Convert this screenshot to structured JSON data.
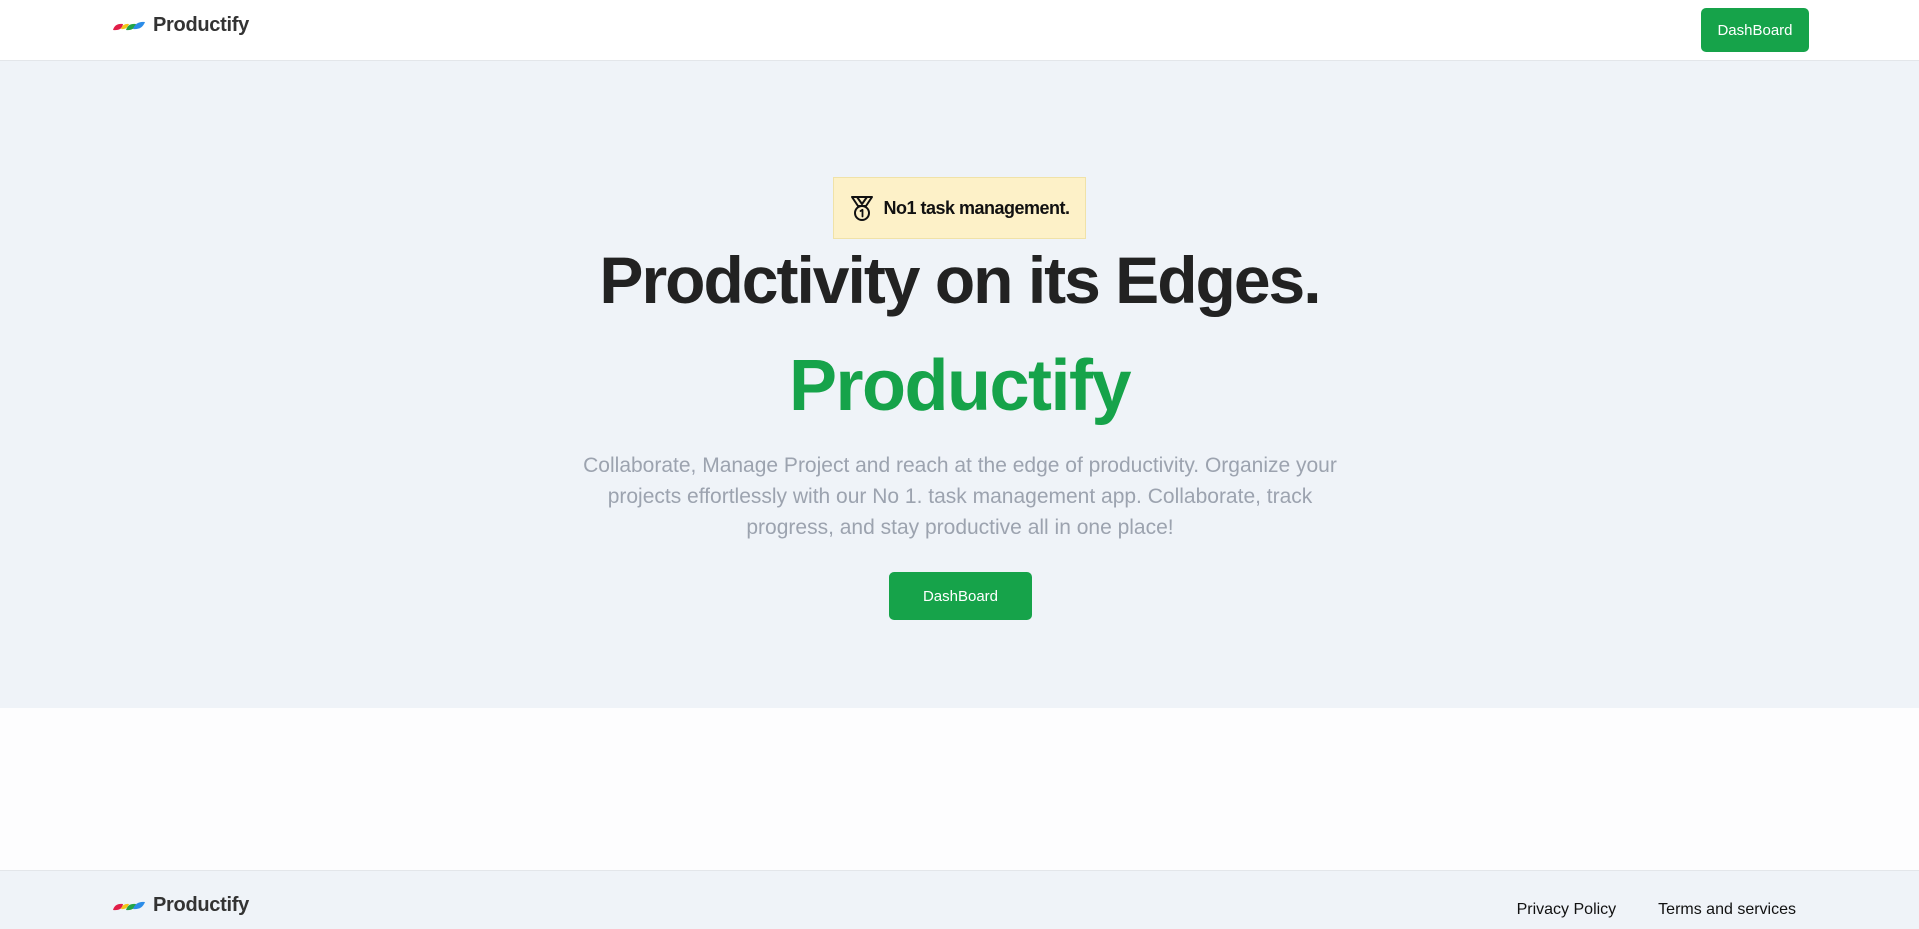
{
  "header": {
    "brand_name": "Productify",
    "dashboard_button": "DashBoard"
  },
  "hero": {
    "badge_icon": "medal-icon",
    "badge_text": "No1 task management.",
    "headline": "Prodctivity on its Edges.",
    "brand_headline": "Productify",
    "description": "Collaborate, Manage Project and reach at the edge of productivity. Organize your projects effortlessly with our No 1. task management app. Collaborate, track progress, and stay productive all in one place!",
    "cta_button": "DashBoard"
  },
  "footer": {
    "brand_name": "Productify",
    "links": [
      "Privacy Policy",
      "Terms and services"
    ]
  },
  "colors": {
    "accent": "#16a34a",
    "hero_background": "#eff3f8",
    "badge_background": "#fdf1c8",
    "muted_text": "#9ca3af",
    "logo_red": "#e11d48",
    "logo_yellow": "#f5c518",
    "logo_green": "#22a447",
    "logo_blue": "#2b8ce8"
  }
}
